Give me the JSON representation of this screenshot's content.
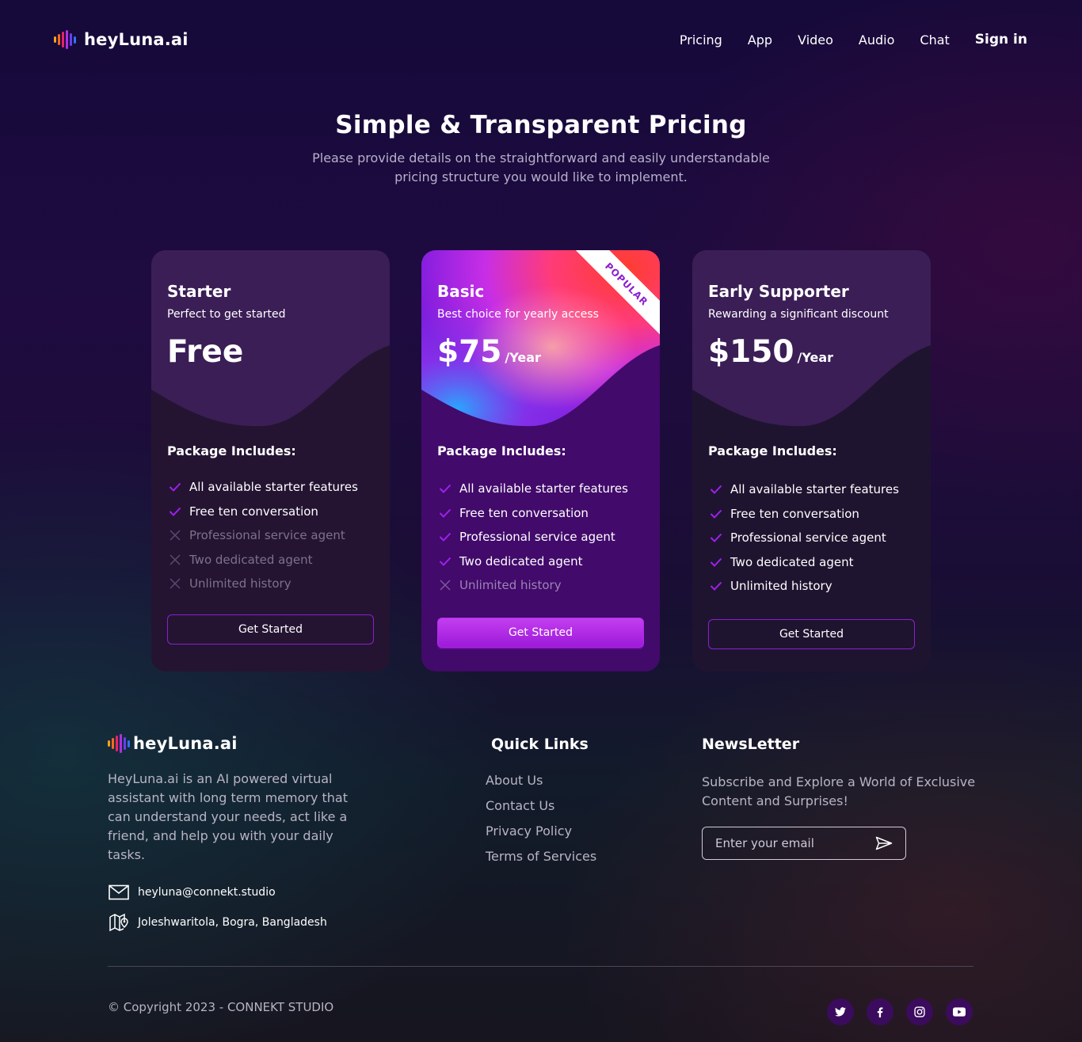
{
  "brand": {
    "name": "heyLuna.ai"
  },
  "nav": {
    "items": [
      "Pricing",
      "App",
      "Video",
      "Audio",
      "Chat"
    ],
    "signin": "Sign in"
  },
  "hero": {
    "title": "Simple & Transparent Pricing",
    "subtitle_line1": "Please provide details on the straightforward and easily understandable",
    "subtitle_line2": "pricing structure you would like to implement."
  },
  "plans": [
    {
      "name": "Starter",
      "desc": "Perfect to get started",
      "price": "Free",
      "period": "",
      "includes": "Package Includes:",
      "features": [
        {
          "text": "All available starter features",
          "included": true
        },
        {
          "text": "Free ten conversation",
          "included": true
        },
        {
          "text": "Professional service agent",
          "included": false
        },
        {
          "text": "Two dedicated agent",
          "included": false
        },
        {
          "text": "Unlimited history",
          "included": false
        }
      ],
      "button": "Get Started"
    },
    {
      "name": "Basic",
      "desc": "Best choice for yearly access",
      "price": "$75",
      "period": "/Year",
      "badge": "POPULAR",
      "includes": "Package Includes:",
      "features": [
        {
          "text": "All available starter features",
          "included": true
        },
        {
          "text": "Free ten conversation",
          "included": true
        },
        {
          "text": "Professional service agent",
          "included": true
        },
        {
          "text": "Two dedicated agent",
          "included": true
        },
        {
          "text": "Unlimited history",
          "included": false
        }
      ],
      "button": "Get Started"
    },
    {
      "name": "Early Supporter",
      "desc": "Rewarding a significant discount",
      "price": "$150",
      "period": "/Year",
      "includes": "Package Includes:",
      "features": [
        {
          "text": "All available starter features",
          "included": true
        },
        {
          "text": "Free ten conversation",
          "included": true
        },
        {
          "text": "Professional service agent",
          "included": true
        },
        {
          "text": "Two dedicated agent",
          "included": true
        },
        {
          "text": "Unlimited history",
          "included": true
        }
      ],
      "button": "Get Started"
    }
  ],
  "footer": {
    "about": "HeyLuna.ai is an AI powered virtual assistant with long term memory that can understand your needs, act like a friend, and help you with your daily tasks.",
    "email": "heyluna@connekt.studio",
    "address": "Joleshwaritola, Bogra, Bangladesh",
    "quick_links_title": "Quick Links",
    "quick_links": [
      "About Us",
      "Contact Us",
      "Privacy Policy",
      "Terms of Services"
    ],
    "newsletter_title": "NewsLetter",
    "newsletter_text": "Subscribe and Explore a World of Exclusive Content and Surprises!",
    "email_placeholder": "Enter your email",
    "copyright": "© Copyright 2023 - CONNEKT STUDIO",
    "socials": [
      "twitter-icon",
      "facebook-icon",
      "instagram-icon",
      "youtube-icon"
    ]
  },
  "colors": {
    "accent": "#9c1ad9",
    "check": "#a020f0"
  }
}
